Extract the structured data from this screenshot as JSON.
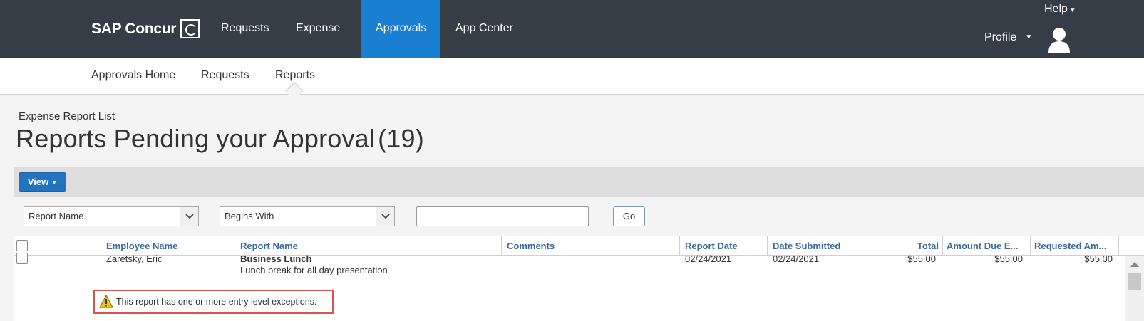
{
  "brand": {
    "name": "SAP Concur"
  },
  "topnav": {
    "items": [
      {
        "label": "Requests"
      },
      {
        "label": "Expense"
      },
      {
        "label": "Approvals"
      },
      {
        "label": "App Center"
      }
    ],
    "active": "Approvals",
    "help_label": "Help",
    "profile_label": "Profile"
  },
  "subnav": {
    "items": [
      {
        "label": "Approvals Home"
      },
      {
        "label": "Requests"
      },
      {
        "label": "Reports"
      }
    ],
    "active": "Reports"
  },
  "page": {
    "breadcrumb": "Expense Report List",
    "title": "Reports Pending your Approval",
    "count": "(19)"
  },
  "toolbar": {
    "view_label": "View"
  },
  "filters": {
    "field_select": "Report Name",
    "operator_select": "Begins With",
    "search_value": "",
    "go_label": "Go"
  },
  "table": {
    "headers": {
      "employee_name": "Employee Name",
      "report_name": "Report Name",
      "comments": "Comments",
      "report_date": "Report Date",
      "date_submitted": "Date Submitted",
      "total": "Total",
      "amount_due": "Amount Due E...",
      "requested_amount": "Requested Am..."
    },
    "rows": [
      {
        "employee_name": "Zaretsky, Eric",
        "report_name": "Business Lunch",
        "report_purpose": "Lunch break for all day presentation",
        "comments": "",
        "report_date": "02/24/2021",
        "date_submitted": "02/24/2021",
        "total": "$55.00",
        "amount_due": "$55.00",
        "requested_amount": "$55.00",
        "exception_message": "This report has one or more entry level exceptions."
      }
    ]
  },
  "colors": {
    "topbar_bg": "#353d47",
    "active_tab": "#1a7fd1",
    "header_link": "#3b6b9c",
    "view_button": "#2274c1",
    "exception_border": "#d9534f",
    "warning_yellow": "#f5c518"
  }
}
